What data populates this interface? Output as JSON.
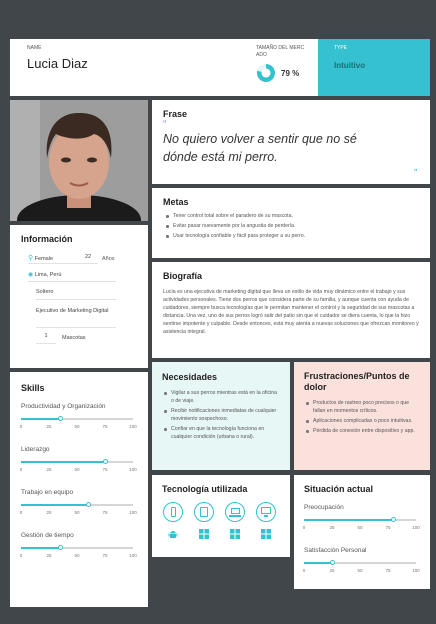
{
  "header": {
    "name_label": "NAME",
    "name": "Lucia Diaz",
    "market_label": "TAMAÑO DEL MERC ADO",
    "market_value": "79 %",
    "market_fraction": 0.79,
    "type_label": "TYPE",
    "type_value": "Intuitivo"
  },
  "quote": {
    "title": "Frase",
    "open_mark": "“",
    "text": "No quiero volver a sentir que no sé dónde está mi perro.",
    "close_mark": "”"
  },
  "goals": {
    "title": "Metas",
    "items": [
      "Tener control total sobre el paradero de su mascota.",
      "Evitar pasar nuevamente por la angustia de perderla.",
      "Usar tecnología confiable y fácil para proteger a su perro."
    ]
  },
  "info": {
    "title": "Información",
    "gender": "Female",
    "age": "22",
    "age_unit": "Años",
    "location": "Lima, Perú",
    "status": "Soltero",
    "occupation": "Ejecutivo de Marketing Digital",
    "pets_count": "1",
    "pets_label": "Mascotas"
  },
  "bio": {
    "title": "Biografía",
    "text": "Lucía es una ejecutiva de marketing digital que lleva un estilo de vida muy dinámico entre el trabajo y sus actividades personales. Tiene dos perros que considera parte de su familia, y aunque cuenta con ayuda de cuidadores, siempre busca tecnologías que le permitan mantener el control y la seguridad de sus mascotas a distancia. Una vez, uno de sus perros logró salir del patio sin que el cuidador se diera cuenta, lo que la hizo sentirse impotente y culpable. Desde entonces, está muy atenta a nuevas soluciones que ofrezcan monitoreo y asistencia integral."
  },
  "skills": {
    "title": "Skills",
    "ticks": [
      "0",
      "25",
      "50",
      "75",
      "100"
    ],
    "items": [
      {
        "label": "Productividad y Organización",
        "value": 35
      },
      {
        "label": "Liderazgo",
        "value": 75
      },
      {
        "label": "Trabajo en equipo",
        "value": 60
      },
      {
        "label": "Gestión de tiempo",
        "value": 35
      }
    ]
  },
  "needs": {
    "title": "Necesidades",
    "items": [
      "Vigilar a sus perros mientras está en la oficina o de viaje.",
      "Recibir notificaciones inmediatas de cualquier movimiento sospechoso.",
      "Confiar en que la tecnología funciona en cualquier condición (urbana o rural)."
    ]
  },
  "frustrations": {
    "title": "Frustraciones/Puntos de dolor",
    "items": [
      "Productos de rastreo poco precisos o que fallan en momentos críticos.",
      "Aplicaciones complicadas o poco intuitivas.",
      "Pérdida de conexión entre dispositivo y app."
    ]
  },
  "tech": {
    "title": "Tecnología utilizada",
    "icons": [
      "smartphone-icon",
      "tablet-icon",
      "laptop-icon",
      "desktop-icon"
    ],
    "os_icons": [
      "android-icon",
      "windows-icon",
      "windows-icon",
      "windows-icon"
    ]
  },
  "situation": {
    "title": "Situación actual",
    "ticks": [
      "0",
      "25",
      "50",
      "75",
      "100"
    ],
    "items": [
      {
        "label": "Preocupación",
        "value": 80
      },
      {
        "label": "Satisfacción Personal",
        "value": 25
      }
    ]
  },
  "colors": {
    "accent": "#35c1d0",
    "needs_bg": "#e6f7f5",
    "frustrations_bg": "#fbe1dc",
    "background": "#41464b"
  }
}
